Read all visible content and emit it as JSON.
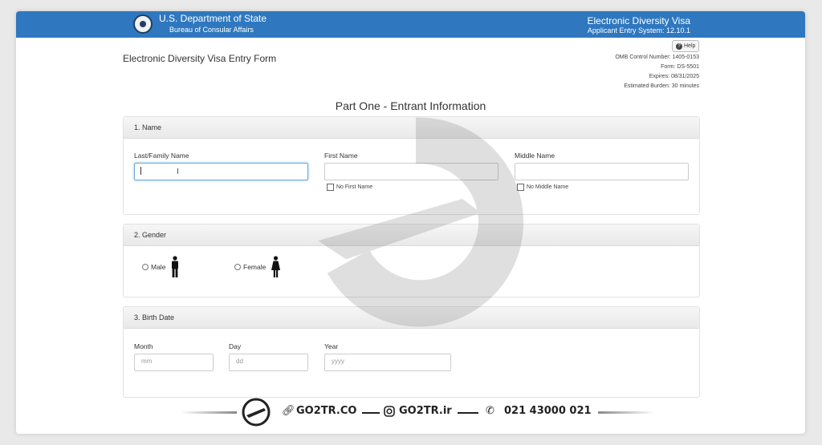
{
  "header": {
    "department": "U.S. Department of State",
    "bureau": "Bureau of Consular Affairs",
    "system_title": "Electronic Diversity Visa",
    "system_subtitle": "Applicant Entry System: 12.10.1"
  },
  "form": {
    "title": "Electronic Diversity Visa Entry Form",
    "help_label": "Help",
    "omb": "OMB Control Number: 1405-0153",
    "form_no": "Form: DS-5501",
    "expires": "Expires: 08/31/2025",
    "burden": "Estimated Burden: 30 minutes",
    "part_title": "Part One - Entrant Information"
  },
  "name_section": {
    "heading": "1. Name",
    "last_label": "Last/Family Name",
    "first_label": "First Name",
    "middle_label": "Middle Name",
    "no_first": "No First Name",
    "no_middle": "No Middle Name"
  },
  "gender_section": {
    "heading": "2. Gender",
    "male": "Male",
    "female": "Female"
  },
  "birth_section": {
    "heading": "3. Birth Date",
    "month_label": "Month",
    "day_label": "Day",
    "year_label": "Year",
    "month_ph": "mm",
    "day_ph": "dd",
    "year_ph": "yyyy"
  },
  "footer": {
    "site": "GO2TR.CO",
    "instagram": "GO2TR.ir",
    "phone": "021 43000 021"
  },
  "colors": {
    "banner": "#2f78bf",
    "focus": "#6fa6dc"
  },
  "icons": [
    "seal-icon",
    "help-icon",
    "male-icon",
    "female-icon",
    "link-icon",
    "instagram-icon",
    "phone-icon",
    "go2tr-logo"
  ]
}
